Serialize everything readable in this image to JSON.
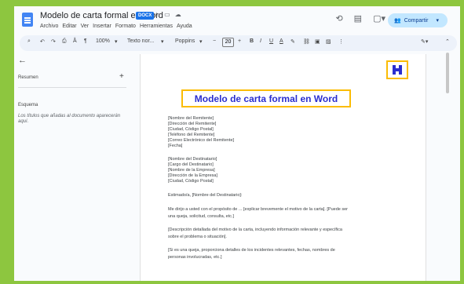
{
  "document": {
    "title": "Modelo de carta formal en Word",
    "badge": "DOCX",
    "menu": [
      "Archivo",
      "Editar",
      "Ver",
      "Insertar",
      "Formato",
      "Herramientas",
      "Ayuda"
    ]
  },
  "header": {
    "share_label": "Compartir"
  },
  "toolbar": {
    "zoom": "100%",
    "style": "Texto nor...",
    "font": "Poppins",
    "font_size": "20",
    "bold": "B",
    "italic": "I",
    "underline": "U",
    "text_color": "A"
  },
  "sidebar": {
    "summary_label": "Resumen",
    "outline_label": "Esquema",
    "outline_hint": "Los títulos que añadas al documento aparecerán aquí."
  },
  "page": {
    "heading": "Modelo de carta formal en Word",
    "sender_block": [
      "[Nombre del Remitente]",
      "[Dirección del Remitente]",
      "[Ciudad, Código Postal]",
      "[Teléfono del Remitente]",
      "[Correo Electrónico del Remitente]",
      "[Fecha]"
    ],
    "recipient_block": [
      "[Nombre del Destinatario]",
      "[Cargo del Destinatario]",
      "[Nombre de la Empresa]",
      "[Dirección de la Empresa]",
      "[Ciudad, Código Postal]"
    ],
    "greeting": "Estimado/a, [Nombre del Destinatario]:",
    "paragraphs": [
      "Me dirijo a usted con el propósito de ... [explicar brevemente el motivo de la carta]. [Puede ser",
      "una queja, solicitud, consulta, etc.]",
      "[Descripción detallada del motivo de la carta, incluyendo información relevante y específica",
      "sobre el problema o situación].",
      "[Si es una queja, proporciona detalles de los incidentes relevantes, fechas, nombres de",
      "personas involucradas, etc.]"
    ]
  },
  "colors": {
    "accent": "#2a2ecf",
    "highlight": "#fbbc04",
    "background": "#8dc63f"
  }
}
